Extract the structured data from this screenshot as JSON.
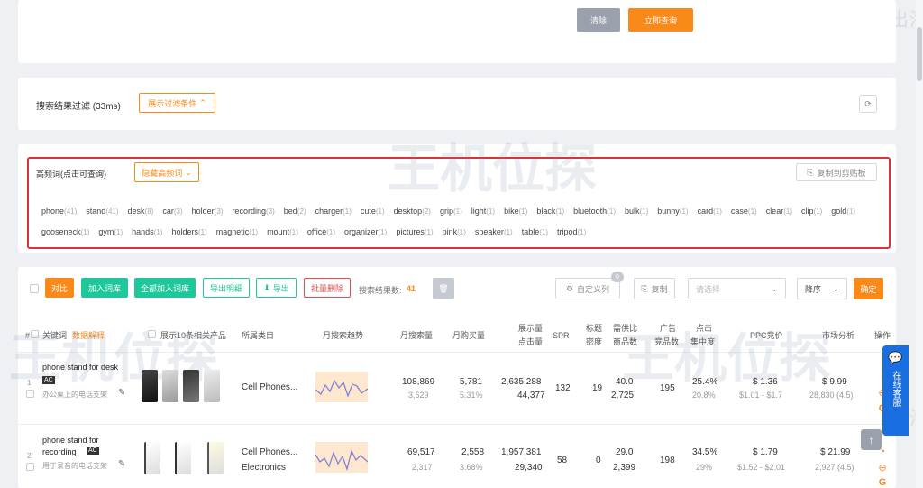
{
  "top_buttons": {
    "clear": "清除",
    "query": "立即查询"
  },
  "filter_bar": {
    "label": "搜索结果过滤 (33ms)",
    "toggle": "展示过滤条件"
  },
  "hf": {
    "title": "高频词(点击可查询)",
    "hide": "隐藏高频词",
    "copy": "复制到剪贴板",
    "words": [
      {
        "w": "phone",
        "c": "(41)"
      },
      {
        "w": "stand",
        "c": "(41)"
      },
      {
        "w": "desk",
        "c": "(8)"
      },
      {
        "w": "car",
        "c": "(3)"
      },
      {
        "w": "holder",
        "c": "(3)"
      },
      {
        "w": "recording",
        "c": "(3)"
      },
      {
        "w": "bed",
        "c": "(2)"
      },
      {
        "w": "charger",
        "c": "(1)"
      },
      {
        "w": "cute",
        "c": "(1)"
      },
      {
        "w": "desktop",
        "c": "(2)"
      },
      {
        "w": "grip",
        "c": "(1)"
      },
      {
        "w": "light",
        "c": "(1)"
      },
      {
        "w": "bike",
        "c": "(1)"
      },
      {
        "w": "black",
        "c": "(1)"
      },
      {
        "w": "bluetooth",
        "c": "(1)"
      },
      {
        "w": "bulk",
        "c": "(1)"
      },
      {
        "w": "bunny",
        "c": "(1)"
      },
      {
        "w": "card",
        "c": "(1)"
      },
      {
        "w": "case",
        "c": "(1)"
      },
      {
        "w": "clear",
        "c": "(1)"
      },
      {
        "w": "clip",
        "c": "(1)"
      },
      {
        "w": "gold",
        "c": "(1)"
      },
      {
        "w": "gooseneck",
        "c": "(1)"
      },
      {
        "w": "gym",
        "c": "(1)"
      },
      {
        "w": "hands",
        "c": "(1)"
      },
      {
        "w": "holders",
        "c": "(1)"
      },
      {
        "w": "magnetic",
        "c": "(1)"
      },
      {
        "w": "mount",
        "c": "(1)"
      },
      {
        "w": "office",
        "c": "(1)"
      },
      {
        "w": "organizer",
        "c": "(1)"
      },
      {
        "w": "pictures",
        "c": "(1)"
      },
      {
        "w": "pink",
        "c": "(1)"
      },
      {
        "w": "speaker",
        "c": "(1)"
      },
      {
        "w": "table",
        "c": "(1)"
      },
      {
        "w": "tripod",
        "c": "(1)"
      }
    ]
  },
  "toolbar": {
    "compare": "对比",
    "add_lib": "加入词库",
    "add_all": "全部加入词库",
    "export_detail": "导出明细",
    "export": "导出",
    "batch_delete": "批量删除",
    "count_label": "搜索结果数:",
    "count": "41",
    "custom_cols": "自定义列",
    "badge": "0",
    "copy": "复制",
    "select_placeholder": "请选择",
    "sort": "降序",
    "confirm": "确定"
  },
  "headers": {
    "idx": "#",
    "keyword": "关键词",
    "data_explain": "数据解释",
    "top10": "展示10条相关产品",
    "category": "所属类目",
    "trend": "月搜索趋势",
    "month_search": "月搜索量",
    "month_buy": "月购买量",
    "impressions": "展示量",
    "clicks": "点击量",
    "spr": "SPR",
    "title_density_1": "标题",
    "title_density_2": "密度",
    "supply_1": "需供比",
    "supply_2": "商品数",
    "ad_1": "广告",
    "ad_2": "竞品数",
    "click_1": "点击",
    "click_2": "集中度",
    "ppc": "PPC竞价",
    "market": "市场分析",
    "ops": "操作"
  },
  "rows": [
    {
      "idx": "1",
      "kw": "phone stand for desk",
      "ac": "AC",
      "cn": "办公桌上的电话支架",
      "cat": "Cell Phones...",
      "cat2": "",
      "search": "108,869",
      "search_sub": "3,629",
      "buy": "5,781",
      "buy_sub": "5.31%",
      "imp": "2,635,288",
      "clicks": "44,377",
      "spr": "132",
      "density": "19",
      "ratio": "40.0",
      "goods": "2,725",
      "ads": "195",
      "conc": "25.4%",
      "conc_sub": "20.8%",
      "ppc": "$ 1.36",
      "ppc_sub": "$1.01 - $1.7",
      "price": "$ 9.99",
      "price_sub": "28,830 (4.5)"
    },
    {
      "idx": "2",
      "kw": "phone stand for recording",
      "ac": "AC",
      "cn": "用于录音的电话支架",
      "cat": "Cell Phones...",
      "cat2": "Electronics",
      "search": "69,517",
      "search_sub": "2,317",
      "buy": "2,558",
      "buy_sub": "3.68%",
      "imp": "1,957,381",
      "clicks": "29,340",
      "spr": "58",
      "density": "0",
      "ratio": "29.0",
      "goods": "2,399",
      "ads": "198",
      "conc": "34.5%",
      "conc_sub": "29%",
      "ppc": "$ 1.79",
      "ppc_sub": "$1.52 - $2.01",
      "price": "$ 21.99",
      "price_sub": "2,927 (4.5)"
    }
  ],
  "watermark": {
    "slogan": "服务跨境电商  助力中企出海",
    "brand": "王机位探"
  },
  "chat": {
    "label": "在线客服"
  }
}
